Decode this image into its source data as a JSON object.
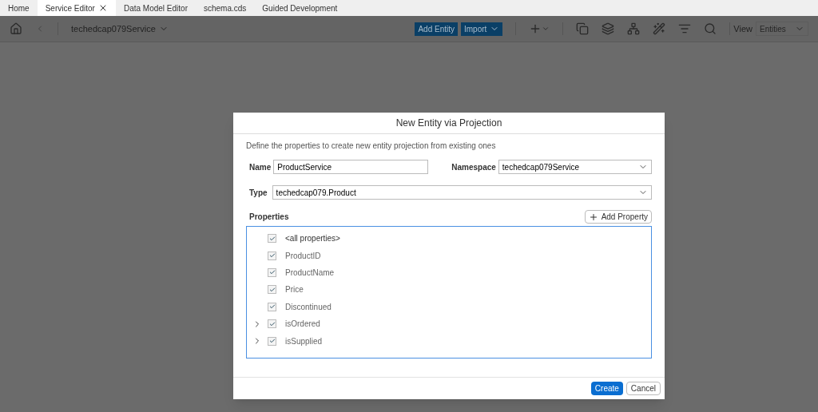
{
  "tabs": [
    {
      "label": "Home",
      "selected": false,
      "closable": false
    },
    {
      "label": "Service Editor",
      "selected": true,
      "closable": true
    },
    {
      "label": "Data Model Editor",
      "selected": false,
      "closable": false
    },
    {
      "label": "schema.cds",
      "selected": false,
      "closable": false
    },
    {
      "label": "Guided Development",
      "selected": false,
      "closable": false
    }
  ],
  "toolbar": {
    "service": "techedcap079Service",
    "add_entity": "Add Entity",
    "import": "Import",
    "view_label": "View",
    "view_value": "Entities"
  },
  "dialog": {
    "title": "New Entity via Projection",
    "description": "Define the properties to create new entity projection from existing ones",
    "name_label": "Name",
    "name_value": "ProductService",
    "namespace_label": "Namespace",
    "namespace_value": "techedcap079Service",
    "type_label": "Type",
    "type_value": "techedcap079.Product",
    "properties_label": "Properties",
    "add_property": "Add Property",
    "properties": [
      {
        "label": "<all properties>",
        "kind": "field",
        "checked": true
      },
      {
        "label": "ProductID",
        "kind": "field",
        "checked": true
      },
      {
        "label": "ProductName",
        "kind": "field",
        "checked": true
      },
      {
        "label": "Price",
        "kind": "field",
        "checked": true
      },
      {
        "label": "Discontinued",
        "kind": "field",
        "checked": true
      },
      {
        "label": "isOrdered",
        "kind": "group",
        "checked": true
      },
      {
        "label": "isSupplied",
        "kind": "group",
        "checked": true
      }
    ],
    "create": "Create",
    "cancel": "Cancel"
  }
}
